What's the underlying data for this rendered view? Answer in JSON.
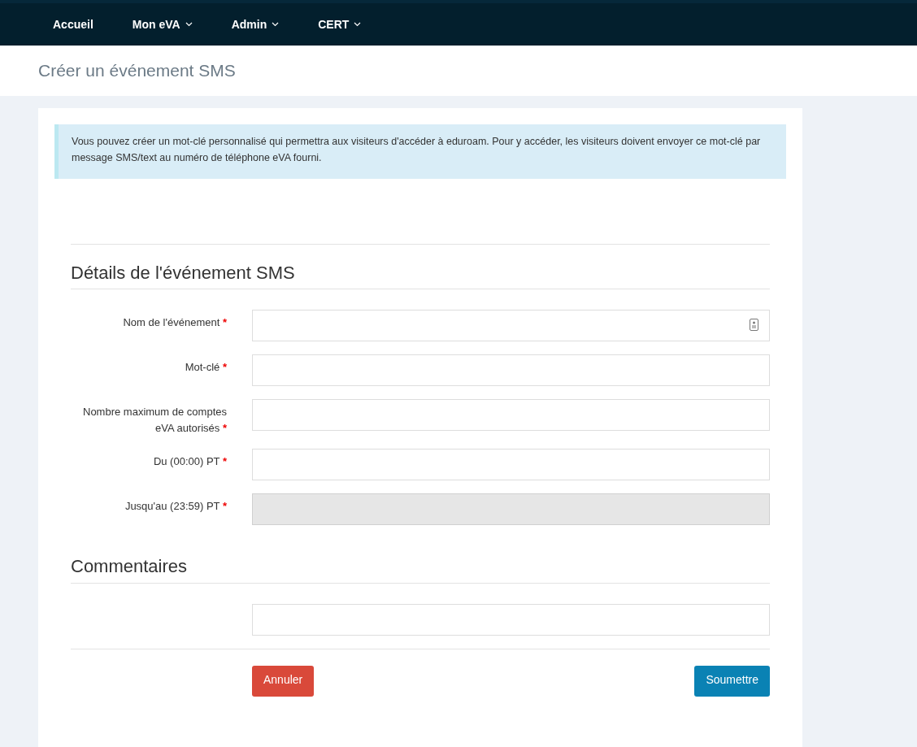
{
  "navbar": {
    "items": [
      {
        "label": "Accueil",
        "dropdown": false
      },
      {
        "label": "Mon eVA",
        "dropdown": true
      },
      {
        "label": "Admin",
        "dropdown": true
      },
      {
        "label": "CERT",
        "dropdown": true
      }
    ]
  },
  "page_title": "Créer un événement SMS",
  "info_alert": "Vous pouvez créer un mot-clé personnalisé qui permettra aux visiteurs d'accéder à eduroam. Pour y accéder, les visiteurs doivent envoyer ce mot-clé par message SMS/text au numéro de téléphone eVA fourni.",
  "sections": [
    {
      "heading": "Détails de l'événement SMS",
      "fields": [
        {
          "label": "Nom de l'événement",
          "required_mark": "*",
          "disabled": false,
          "autofill_icon": true
        },
        {
          "label": "Mot-clé",
          "required_mark": "*",
          "disabled": false,
          "autofill_icon": false
        },
        {
          "label": "Nombre maximum de comptes eVA autorisés",
          "required_mark": "*",
          "disabled": false,
          "autofill_icon": false
        },
        {
          "label": "Du (00:00) PT",
          "required_mark": "*",
          "disabled": false,
          "autofill_icon": false
        },
        {
          "label": "Jusqu'au (23:59) PT",
          "required_mark": "*",
          "disabled": true,
          "autofill_icon": false
        }
      ]
    },
    {
      "heading": "Commentaires",
      "fields": [
        {
          "disabled": false,
          "autofill_icon": false
        }
      ]
    }
  ],
  "buttons": [
    {
      "label": "Annuler",
      "kind": "cancel"
    },
    {
      "label": "Soumettre",
      "kind": "submit"
    }
  ]
}
